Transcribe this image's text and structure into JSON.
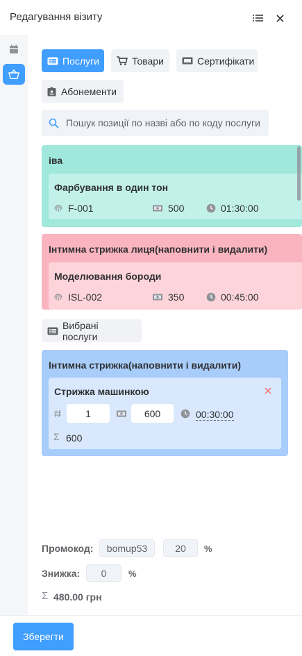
{
  "header": {
    "title": "Редагування візиту"
  },
  "tabs": [
    {
      "label": "Послуги"
    },
    {
      "label": "Товари"
    },
    {
      "label": "Сертифікати"
    },
    {
      "label": "Абонементи"
    }
  ],
  "search": {
    "placeholder": "Пошук позиції по назві або по коду послуги"
  },
  "categories": [
    {
      "title": "іва",
      "color": "#a0e7dc",
      "inner_color": "#c2f1ea",
      "service": {
        "name": "Фарбування в один тон",
        "code": "F-001",
        "price": "500",
        "duration": "01:30:00"
      }
    },
    {
      "title": "Інтимна стрижка лиця(наповнити і видалити)",
      "color": "#fab4bf",
      "inner_color": "#fdd4da",
      "service": {
        "name": "Моделювання бороди",
        "code": "ISL-002",
        "price": "350",
        "duration": "00:45:00"
      }
    }
  ],
  "selected_header": {
    "label": "Вибрані послуги"
  },
  "selected": {
    "title": "Інтимна стрижка(наповнити і видалити)",
    "color": "#a8cdfa",
    "item": {
      "name": "Стрижка машинкою",
      "quantity": "1",
      "price": "600",
      "duration": "00:30:00",
      "total": "600"
    }
  },
  "summary": {
    "promo_label": "Промокод:",
    "promo_code": "bomup53",
    "promo_value": "20",
    "percent_sign": "%",
    "discount_label": "Знижка:",
    "discount_value": "0",
    "total": "480.00 грн"
  },
  "footer": {
    "save_label": "Зберегти"
  },
  "colors": {
    "accent": "#409eff"
  }
}
